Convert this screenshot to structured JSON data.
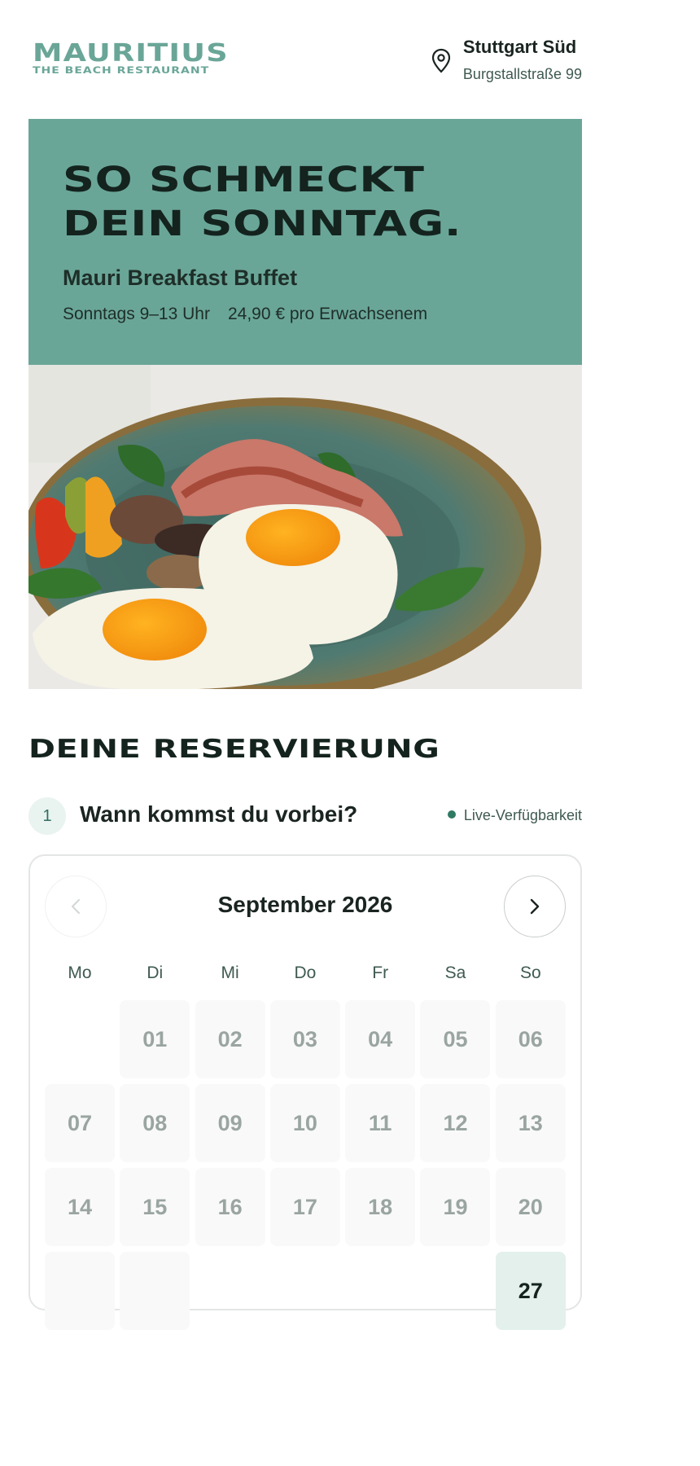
{
  "header": {
    "logo_main": "MAURITIUS",
    "logo_sub": "THE BEACH RESTAURANT",
    "location_name": "Stuttgart Süd",
    "location_street": "Burgstallstraße 99",
    "pin_icon": "map-pin-icon"
  },
  "hero": {
    "title_line1": "SO SCHMECKT",
    "title_line2": "DEIN SONNTAG.",
    "subtitle": "Mauri Breakfast Buffet",
    "time": "Sonntags 9–13 Uhr",
    "price": "24,90 € pro Erwachsenem",
    "background_color": "#6aa698"
  },
  "reservation": {
    "title": "DEINE RESERVIERUNG",
    "step_number": "1",
    "step_label": "Wann kommst du vorbei?",
    "live_label": "Live-Verfügbarkeit"
  },
  "calendar": {
    "month": "September 2026",
    "prev_icon": "chevron-left-icon",
    "next_icon": "chevron-right-icon",
    "weekdays": [
      "Mo",
      "Di",
      "Mi",
      "Do",
      "Fr",
      "Sa",
      "So"
    ],
    "days": [
      "",
      "01",
      "02",
      "03",
      "04",
      "05",
      "06",
      "07",
      "08",
      "09",
      "10",
      "11",
      "12",
      "13",
      "14",
      "15",
      "16",
      "17",
      "18",
      "19",
      "20",
      "",
      "",
      "",
      "",
      "",
      "",
      "27"
    ],
    "selected_day": "27",
    "accent_color": "#e3f0ec"
  }
}
